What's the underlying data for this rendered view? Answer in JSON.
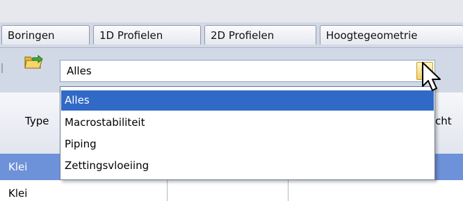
{
  "tabs": [
    {
      "label": "Boringen"
    },
    {
      "label": "1D Profielen"
    },
    {
      "label": "2D Profielen"
    },
    {
      "label": "Hoogtegeometrie"
    }
  ],
  "toolbar": {
    "folder_icon": "open-folder-icon"
  },
  "combo": {
    "value": "Alles",
    "button_icon": "chevron-down-icon"
  },
  "dropdown": {
    "options": [
      "Alles",
      "Macrostabiliteit",
      "Piping",
      "Zettingsvloeiing"
    ],
    "selected": "Alles"
  },
  "grid": {
    "header_left": "Type",
    "header_right_fragment": "cht",
    "rows": [
      {
        "type": "Klei"
      },
      {
        "type": "Klei"
      }
    ]
  },
  "colors": {
    "selection": "#3169c6",
    "row_selected": "#6e92d9"
  }
}
